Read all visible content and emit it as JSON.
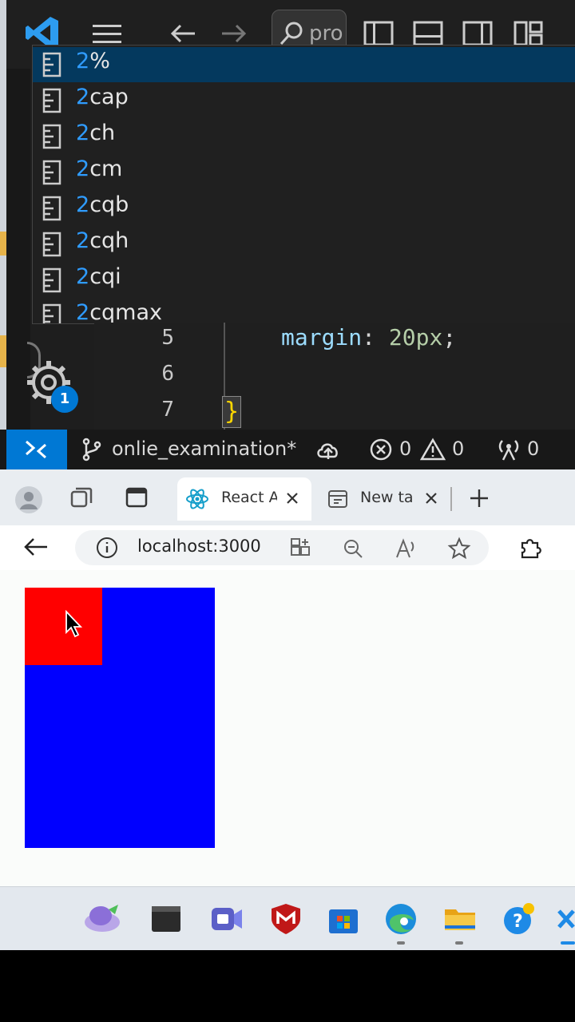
{
  "vscode": {
    "search_text": "pro",
    "suggestions": [
      {
        "prefix": "2",
        "rest": "%"
      },
      {
        "prefix": "2",
        "rest": "cap"
      },
      {
        "prefix": "2",
        "rest": "ch"
      },
      {
        "prefix": "2",
        "rest": "cm"
      },
      {
        "prefix": "2",
        "rest": "cqb"
      },
      {
        "prefix": "2",
        "rest": "cqh"
      },
      {
        "prefix": "2",
        "rest": "cqi"
      },
      {
        "prefix": "2",
        "rest": "cqmax"
      }
    ],
    "editor": {
      "lines": [
        "5",
        "6",
        "7"
      ],
      "code_property": "margin",
      "code_colon": ": ",
      "code_value": "20px",
      "code_semicolon": ";",
      "closing_brace": "}"
    },
    "gear_badge": "1",
    "statusbar": {
      "branch": "onlie_examination*",
      "errors": "0",
      "warnings": "0",
      "ports": "0"
    }
  },
  "browser": {
    "tabs": [
      {
        "title": "React A",
        "active": true
      },
      {
        "title": "New ta",
        "active": false
      }
    ],
    "url": "localhost:3000",
    "colors": {
      "outer_box": "#0000ff",
      "inner_box": "#ff0000"
    }
  },
  "taskbar": {
    "apps": [
      "copilot-app",
      "terminal-app",
      "teams-app",
      "mcafee-app",
      "store-app",
      "edge-app",
      "file-explorer-app",
      "help-app",
      "vscode-app"
    ]
  }
}
